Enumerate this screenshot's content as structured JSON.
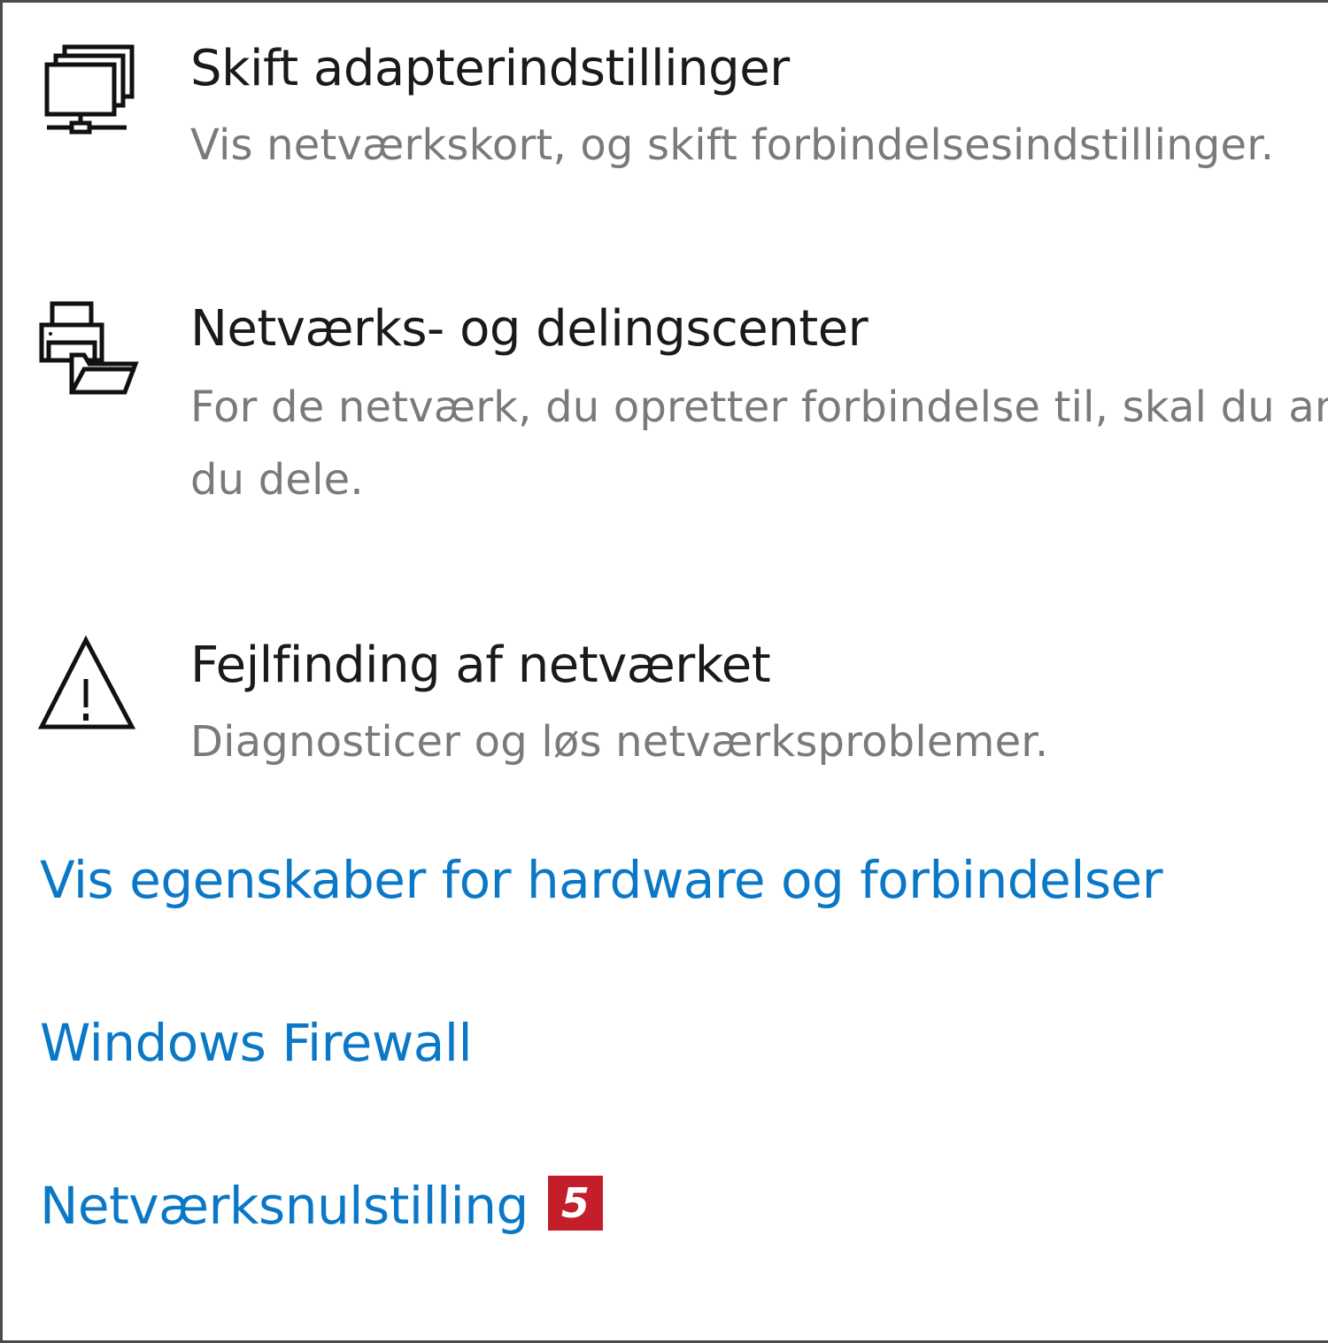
{
  "settings": [
    {
      "icon": "network-adapter-icon",
      "title": "Skift adapterindstillinger",
      "description": "Vis netværkskort, og skift forbindelsesindstillinger."
    },
    {
      "icon": "network-sharing-center-icon",
      "title": "Netværks- og delingscenter",
      "description_line1": "For de netværk, du opretter forbindelse til, skal du angive, hvad",
      "description_line2": "du dele."
    },
    {
      "icon": "warning-triangle-icon",
      "title": "Fejlfinding af netværket",
      "description": "Diagnosticer og løs netværksproblemer."
    }
  ],
  "links": {
    "hardware": "Vis egenskaber for hardware og forbindelser",
    "firewall": "Windows Firewall",
    "reset": "Netværksnulstilling",
    "reset_badge": "5"
  },
  "colors": {
    "link": "#0a78c7",
    "title": "#1a1a1a",
    "description": "#7a7a7a",
    "badge": "#c41e2a"
  }
}
